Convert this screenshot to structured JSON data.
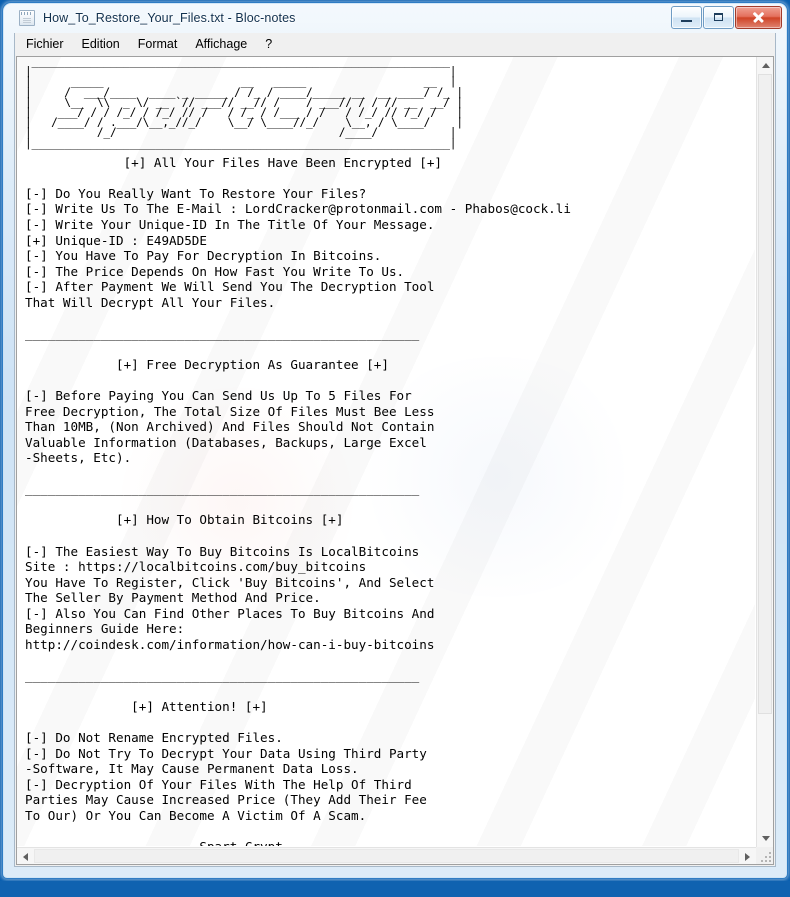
{
  "window": {
    "title": "How_To_Restore_Your_Files.txt - Bloc-notes",
    "icon": "notepad-icon",
    "minimize_label": "Réduire",
    "maximize_label": "Agrandir",
    "close_label": "Fermer",
    "accent_close_color": "#cf4326",
    "frame_color": "#0a5fb0"
  },
  "menu": {
    "items": [
      {
        "label": "Fichier"
      },
      {
        "label": "Edition"
      },
      {
        "label": "Format"
      },
      {
        "label": "Affichage"
      },
      {
        "label": "?"
      }
    ]
  },
  "scrollbars": {
    "vertical": {
      "up_arrow": "scroll-up-icon",
      "down_arrow": "scroll-down-icon"
    },
    "horizontal": {
      "left_arrow": "scroll-left-icon",
      "right_arrow": "scroll-right-icon"
    },
    "resize_grip": "resize-grip-icon"
  },
  "note": {
    "ascii_art": " ________________________________________________________________\n|                                                                |\n|      _____                     __   _____                  __  |\n|     /  ___/____  ____ _ _____ / /_ / ____/_____ __  __ ____/ /_ |\n|     \\__  \\\\  _ \\/ __ `// ___// __// /    / ___// / / // __  __/ |\n|    ___/ / / /_/ / /_/ // /   / /_ / /___ / /   / /_/ // /_/ /   |\n|   /____/ / .___/\\__,_//_/    \\__/ \\____//_/    \\__, / \\____/    |\n|          /_/                                  /____/           |\n|________________________________________________________________|",
    "ascii_art_title": "Spart Crypt",
    "sections": [
      {
        "heading": "             [+] All Your Files Have Been Encrypted [+]",
        "lines": [
          "[-] Do You Really Want To Restore Your Files?",
          "[-] Write Us To The E-Mail : LordCracker@protonmail.com - Phabos@cock.li",
          "[-] Write Your Unique-ID In The Title Of Your Message.",
          "[+] Unique-ID : E49AD5DE",
          "[-] You Have To Pay For Decryption In Bitcoins.",
          "[-] The Price Depends On How Fast You Write To Us.",
          "[-] After Payment We Will Send You The Decryption Tool",
          "That Will Decrypt All Your Files."
        ]
      },
      {
        "divider": "____________________________________________________",
        "heading": "            [+] Free Decryption As Guarantee [+]",
        "lines": [
          "[-] Before Paying You Can Send Us Up To 5 Files For",
          "Free Decryption, The Total Size Of Files Must Bee Less",
          "Than 10MB, (Non Archived) And Files Should Not Contain",
          "Valuable Information (Databases, Backups, Large Excel",
          "-Sheets, Etc)."
        ]
      },
      {
        "divider": "____________________________________________________",
        "heading": "            [+] How To Obtain Bitcoins [+]",
        "lines": [
          "[-] The Easiest Way To Buy Bitcoins Is LocalBitcoins",
          "Site : https://localbitcoins.com/buy_bitcoins",
          "You Have To Register, Click 'Buy Bitcoins', And Select",
          "The Seller By Payment Method And Price.",
          "[-] Also You Can Find Other Places To Buy Bitcoins And",
          "Beginners Guide Here:",
          "http://coindesk.com/information/how-can-i-buy-bitcoins"
        ]
      },
      {
        "divider": "____________________________________________________",
        "heading": "              [+] Attention! [+]",
        "lines": [
          "[-] Do Not Rename Encrypted Files.",
          "[-] Do Not Try To Decrypt Your Data Using Third Party",
          "-Software, It May Cause Permanent Data Loss.",
          "[-] Decryption Of Your Files With The Help Of Third",
          "Parties May Cause Increased Price (They Add Their Fee",
          "To Our) Or You Can Become A Victim Of A Scam."
        ]
      }
    ],
    "footer": "_______________________Spart_Crypt___________________",
    "unique_id": "E49AD5DE",
    "emails": [
      "LordCracker@protonmail.com",
      "Phabos@cock.li"
    ],
    "urls": [
      "https://localbitcoins.com/buy_bitcoins",
      "http://coindesk.com/information/how-can-i-buy-bitcoins"
    ],
    "body_text": "             [+] All Your Files Have Been Encrypted [+]\n\n[-] Do You Really Want To Restore Your Files?\n[-] Write Us To The E-Mail : LordCracker@protonmail.com - Phabos@cock.li\n[-] Write Your Unique-ID In The Title Of Your Message.\n[+] Unique-ID : E49AD5DE\n[-] You Have To Pay For Decryption In Bitcoins.\n[-] The Price Depends On How Fast You Write To Us.\n[-] After Payment We Will Send You The Decryption Tool\nThat Will Decrypt All Your Files.\n\n____________________________________________________\n\n            [+] Free Decryption As Guarantee [+]\n\n[-] Before Paying You Can Send Us Up To 5 Files For\nFree Decryption, The Total Size Of Files Must Bee Less\nThan 10MB, (Non Archived) And Files Should Not Contain\nValuable Information (Databases, Backups, Large Excel\n-Sheets, Etc).\n\n____________________________________________________\n\n            [+] How To Obtain Bitcoins [+]\n\n[-] The Easiest Way To Buy Bitcoins Is LocalBitcoins\nSite : https://localbitcoins.com/buy_bitcoins\nYou Have To Register, Click 'Buy Bitcoins', And Select\nThe Seller By Payment Method And Price.\n[-] Also You Can Find Other Places To Buy Bitcoins And\nBeginners Guide Here:\nhttp://coindesk.com/information/how-can-i-buy-bitcoins\n\n____________________________________________________\n\n              [+] Attention! [+]\n\n[-] Do Not Rename Encrypted Files.\n[-] Do Not Try To Decrypt Your Data Using Third Party\n-Software, It May Cause Permanent Data Loss.\n[-] Decryption Of Your Files With The Help Of Third\nParties May Cause Increased Price (They Add Their Fee\nTo Our) Or You Can Become A Victim Of A Scam.\n\n_______________________Spart_Crypt___________________"
  }
}
